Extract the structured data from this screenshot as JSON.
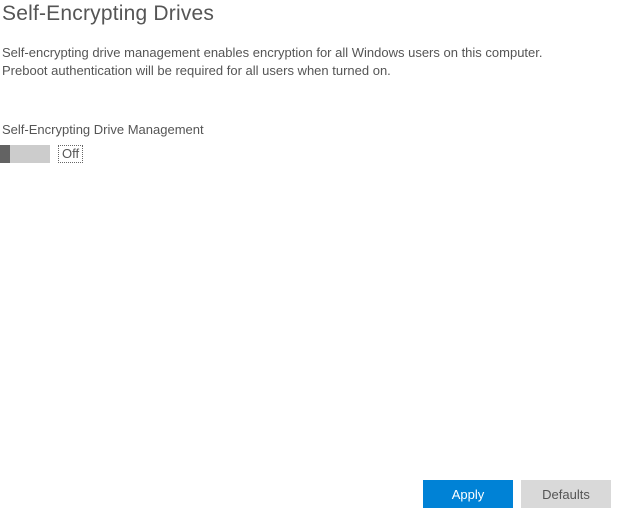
{
  "header": {
    "title": "Self-Encrypting Drives"
  },
  "description": {
    "line1": "Self-encrypting drive management enables encryption for all Windows users on this computer.",
    "line2": "Preboot authentication will be required for all users when turned on."
  },
  "section": {
    "label": "Self-Encrypting Drive Management",
    "toggle_state": "Off",
    "toggle_on": false
  },
  "footer": {
    "apply_label": "Apply",
    "defaults_label": "Defaults"
  },
  "colors": {
    "accent": "#0082d6",
    "secondary_bg": "#d9d9d9",
    "text": "#555555"
  }
}
